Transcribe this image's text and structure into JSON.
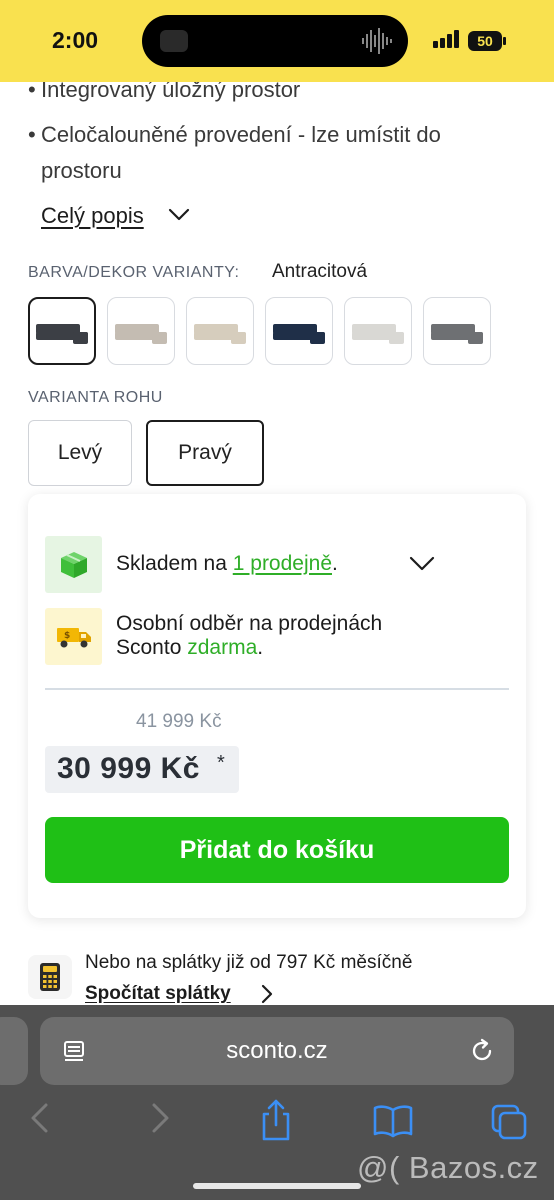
{
  "status_bar": {
    "time": "2:00",
    "battery": "50"
  },
  "description": {
    "bullets": [
      "Integrovaný úložný prostor",
      "Celočalouněné provedení - lze umístit do prostoru"
    ],
    "bullet_glyph": "•",
    "more_link": "Celý popis"
  },
  "variants": {
    "color_label": "BARVA/DEKOR VARIANTY:",
    "color_value": "Antracitová",
    "swatch_colors": [
      "#3c3f45",
      "#c4bcb2",
      "#d6cdbd",
      "#1f2f48",
      "#d9d8d4",
      "#6e7073"
    ],
    "corner_label": "VARIANTA ROHU",
    "corner_options": [
      "Levý",
      "Pravý"
    ],
    "corner_selected": "Pravý"
  },
  "availability": {
    "stock_prefix": "Skladem na",
    "stock_link": "1 prodejně",
    "stock_suffix": ".",
    "pickup_line1": "Osobní odběr na prodejnách",
    "pickup_line2_prefix": "Sconto",
    "pickup_free": "zdarma",
    "pickup_suffix": "."
  },
  "pricing": {
    "old_price": "41 999 Kč",
    "price": "30 999 Kč",
    "price_note": "*",
    "add_to_cart": "Přidat do košíku"
  },
  "installments": {
    "text": "Nebo na splátky již od 797 Kč měsíčně",
    "link": "Spočítat splátky"
  },
  "browser": {
    "url": "sconto.cz"
  },
  "watermark": "@( Bazos.cz",
  "colors": {
    "accent_green": "#1fc016",
    "brand_yellow": "#f9e14f",
    "link_green": "#2fae28"
  }
}
